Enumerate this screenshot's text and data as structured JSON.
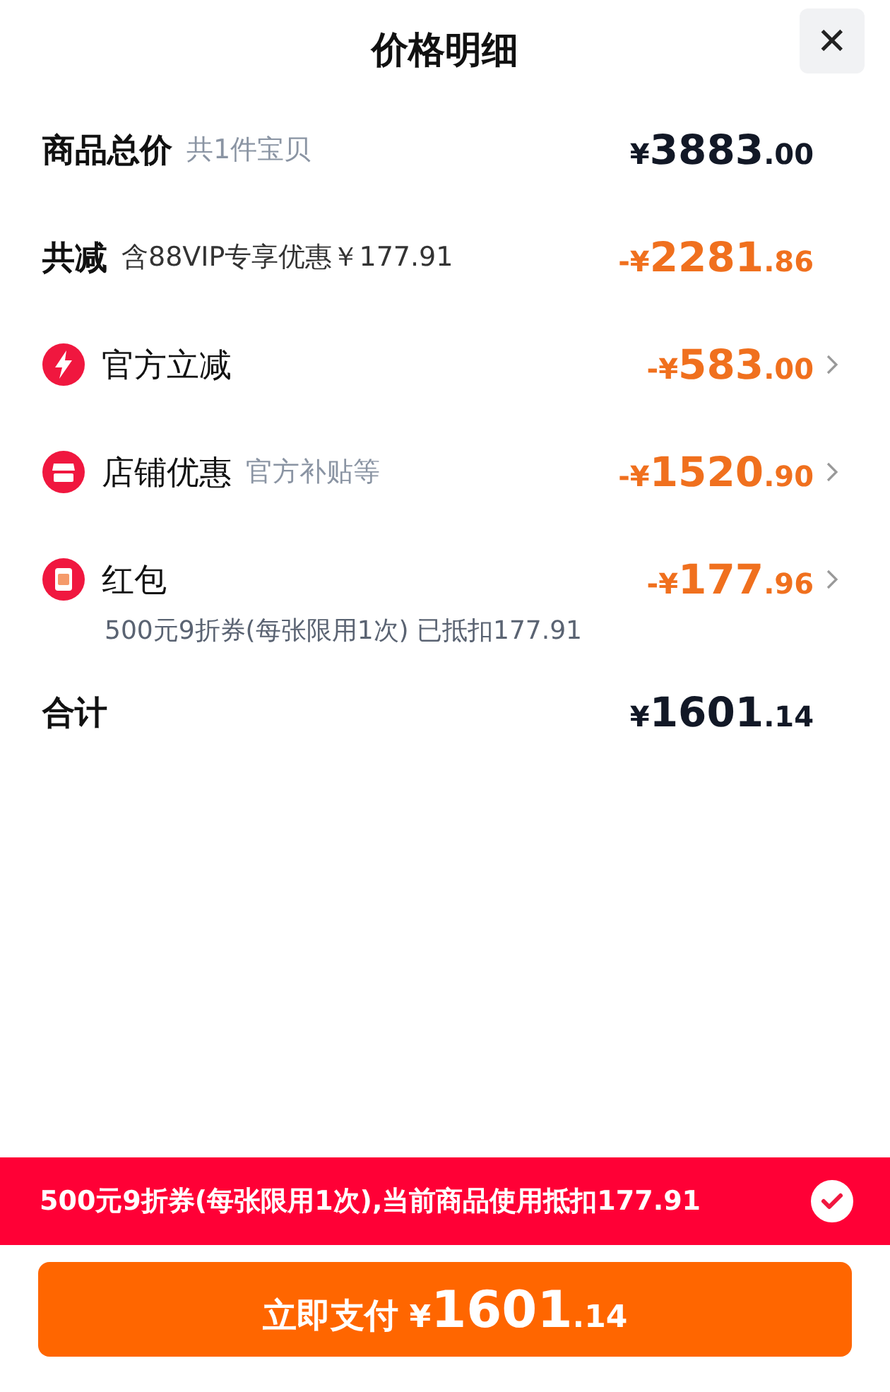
{
  "header": {
    "title": "价格明细",
    "close": "✕"
  },
  "rows": [
    {
      "label": "商品总价",
      "note": "共1件宝贝",
      "kind": "plain",
      "discount": false,
      "chevron": false,
      "price": {
        "prefix": "¥",
        "main": "3883",
        "cents": ".00"
      }
    },
    {
      "label": "共减",
      "note": "含88VIP专享优惠￥177.91",
      "kind": "plain",
      "discount": true,
      "chevron": false,
      "price": {
        "prefix": "-¥",
        "main": "2281",
        "cents": ".86"
      }
    },
    {
      "label": "官方立减",
      "kind": "bolt",
      "discount": true,
      "chevron": true,
      "price": {
        "prefix": "-¥",
        "main": "583",
        "cents": ".00"
      }
    },
    {
      "label": "店铺优惠",
      "note": "官方补贴等",
      "kind": "shop",
      "discount": true,
      "chevron": true,
      "price": {
        "prefix": "-¥",
        "main": "1520",
        "cents": ".90"
      }
    },
    {
      "label": "红包",
      "kind": "redpacket",
      "discount": true,
      "chevron": true,
      "sub": "500元9折券(每张限用1次) 已抵扣177.91",
      "price": {
        "prefix": "-¥",
        "main": "177",
        "cents": ".96"
      }
    },
    {
      "label": "合计",
      "kind": "plain",
      "discount": false,
      "chevron": false,
      "price": {
        "prefix": "¥",
        "main": "1601",
        "cents": ".14"
      }
    }
  ],
  "banner": {
    "text": "500元9折券(每张限用1次),当前商品使用抵扣177.91",
    "checked": true
  },
  "pay_button": {
    "label": "立即支付",
    "prefix": "¥",
    "main": "1601",
    "cents": ".14"
  }
}
